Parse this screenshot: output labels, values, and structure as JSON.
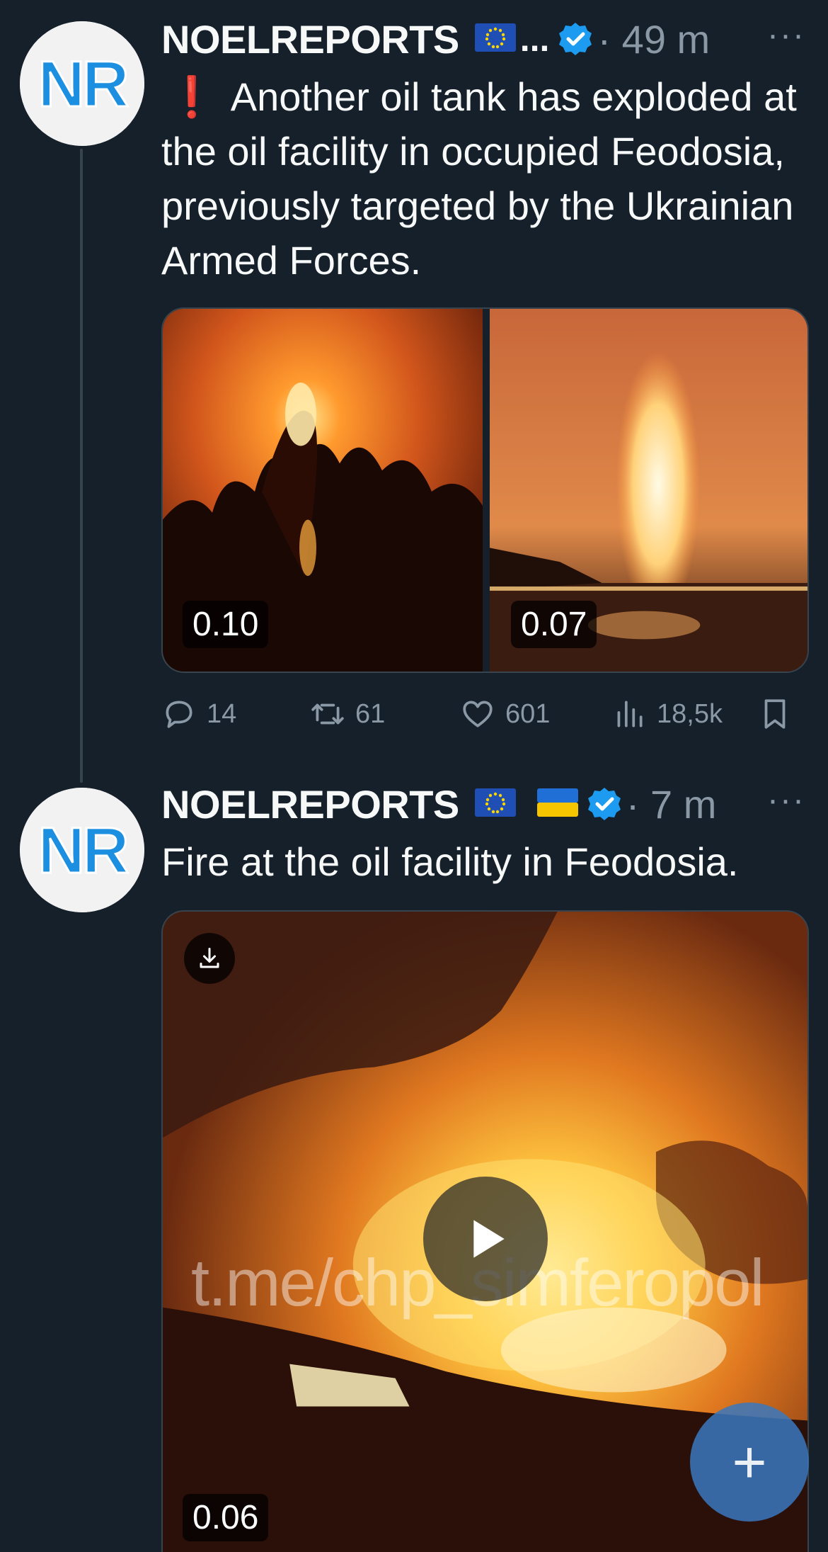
{
  "tweets": [
    {
      "author": "NOELREPORTS",
      "avatar_text": "NR",
      "truncation": "...",
      "time": "49 m",
      "more": "···",
      "alert_icon": "❗",
      "text": "Another oil tank has exploded at the oil facility in occupied Feodosia, previously targeted by the Ukrainian Armed Forces.",
      "media": [
        {
          "type": "video",
          "duration": "0.10"
        },
        {
          "type": "video",
          "duration": "0.07"
        }
      ],
      "stats": {
        "replies": "14",
        "reposts": "61",
        "likes": "601",
        "views": "18,5k"
      }
    },
    {
      "author": "NOELREPORTS",
      "avatar_text": "NR",
      "time": "7 m",
      "more": "···",
      "text": "Fire at the oil facility in Feodosia.",
      "media": [
        {
          "type": "video",
          "duration": "0.06",
          "watermark": "t.me/chp_simferopol"
        }
      ]
    }
  ],
  "icons": {
    "flag_eu": "eu-flag-icon",
    "flag_ua": "ukraine-flag-icon",
    "verified": "verified-badge-icon",
    "reply": "reply-icon",
    "repost": "repost-icon",
    "like": "heart-icon",
    "views": "views-icon",
    "bookmark": "bookmark-icon",
    "download": "download-icon",
    "play": "play-icon",
    "compose": "compose-plus-icon"
  },
  "fab": {
    "label": "+"
  },
  "colors": {
    "background": "#15202b",
    "text": "#f7f9f9",
    "muted": "#8b98a5",
    "verified": "#1d9bf0",
    "avatar_blue": "#1d8fe0"
  }
}
